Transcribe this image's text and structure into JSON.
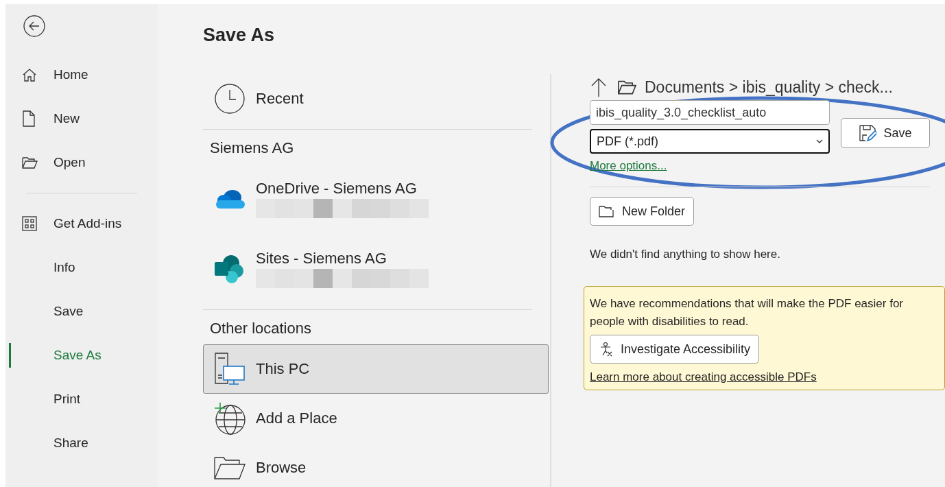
{
  "sidebar": {
    "back": {
      "kind": "back"
    },
    "items": [
      {
        "kind": "home",
        "label": "Home",
        "selected": false
      },
      {
        "kind": "new",
        "label": "New",
        "selected": false
      },
      {
        "kind": "open",
        "label": "Open",
        "selected": false
      },
      {
        "kind": "divider"
      },
      {
        "kind": "addins",
        "label": "Get Add-ins",
        "selected": false
      },
      {
        "kind": "text",
        "label": "Info",
        "selected": false
      },
      {
        "kind": "text",
        "label": "Save",
        "selected": false
      },
      {
        "kind": "text",
        "label": "Save As",
        "selected": true
      },
      {
        "kind": "text",
        "label": "Print",
        "selected": false
      },
      {
        "kind": "text",
        "label": "Share",
        "selected": false
      }
    ]
  },
  "page": {
    "title": "Save As"
  },
  "locations": [
    {
      "kind": "clock",
      "label": "Recent",
      "selected": false
    },
    {
      "kind": "heading",
      "label": "Siemens AG"
    },
    {
      "kind": "onedrive",
      "label": "OneDrive - Siemens AG",
      "redacted": true,
      "selected": false
    },
    {
      "kind": "sharepoint",
      "label": "Sites - Siemens AG",
      "redacted": true,
      "selected": false
    },
    {
      "kind": "heading",
      "label": "Other locations"
    },
    {
      "kind": "pc",
      "label": "This PC",
      "selected": true
    },
    {
      "kind": "globe",
      "label": "Add a Place",
      "selected": false
    },
    {
      "kind": "folder",
      "label": "Browse",
      "selected": false
    }
  ],
  "save_panel": {
    "breadcrumb": "Documents > ibis_quality > check...",
    "file_name": "ibis_quality_3.0_checklist_auto",
    "file_type": "PDF (*.pdf)",
    "save_button": "Save",
    "more_options": "More options...",
    "new_folder": "New Folder",
    "empty_message": "We didn't find anything to show here.",
    "accessibility": {
      "message": "We have recommendations that will make the PDF easier for people with disabilities to read.",
      "button": "Investigate Accessibility",
      "link": "Learn more about creating accessible PDFs"
    }
  },
  "annotation": {
    "kind": "ellipse"
  }
}
